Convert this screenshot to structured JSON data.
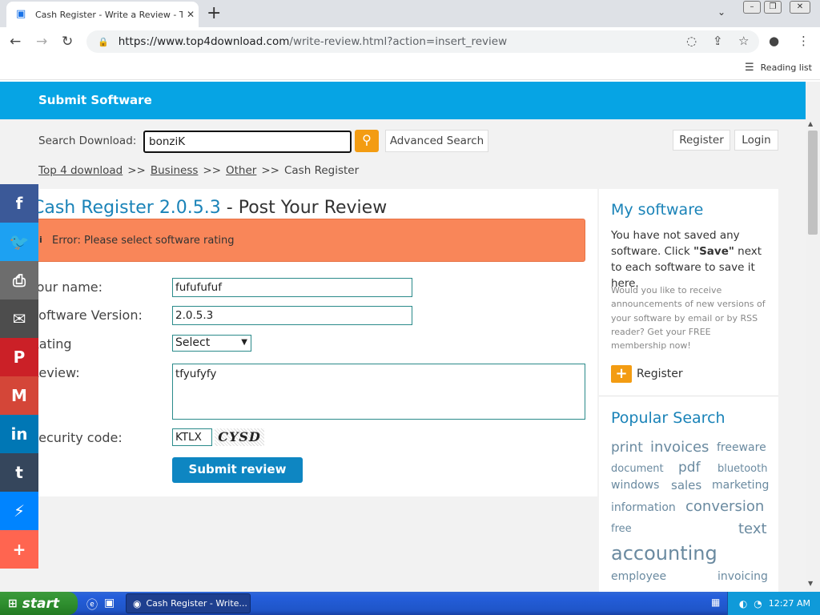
{
  "browser": {
    "tab_title": "Cash Register - Write a Review - To",
    "url_host": "https://www.top4download.com",
    "url_path": "/write-review.html?action=insert_review",
    "reading_list": "Reading list"
  },
  "header": {
    "title": "Submit Software"
  },
  "search": {
    "label": "Search Download:",
    "value": "bonziK",
    "advanced_label": "Advanced Search"
  },
  "account": {
    "register": "Register",
    "login": "Login"
  },
  "breadcrumb": {
    "home": "Top 4 download",
    "cat": "Business",
    "sub": "Other",
    "current": "Cash Register",
    "sep": ">>"
  },
  "form": {
    "product": "Cash Register 2.0.5.3",
    "title_suffix": " - Post Your Review",
    "error": "Error: Please select software rating",
    "name_label": "Your name:",
    "name_value": "fufufufuf",
    "version_label": "Software Version:",
    "version_value": "2.0.5.3",
    "rating_label": "Rating",
    "rating_value": "Select",
    "review_label": "Review:",
    "review_value": "tfyufyfy",
    "security_label": "Security code:",
    "security_value": "KTLX",
    "captcha_text": "CYSD",
    "submit": "Submit review"
  },
  "sidebar": {
    "my_software_title": "My software",
    "my_software_text_1": "You have not saved any software. Click ",
    "my_software_save": "\"Save\"",
    "my_software_text_2": " next to each software to save it here.",
    "promo": "Would you like to receive announcements of new versions of your software by email or by RSS reader? Get your FREE membership now!",
    "register": "Register",
    "popular_title": "Popular Search",
    "tags": [
      "print",
      "invoices",
      "freeware",
      "document",
      "pdf",
      "bluetooth",
      "windows",
      "sales",
      "marketing",
      "information",
      "conversion",
      "free",
      "text",
      "accounting",
      "employee",
      "invoicing"
    ]
  },
  "social": [
    {
      "name": "facebook",
      "glyph": "f",
      "color": "#3b5998"
    },
    {
      "name": "twitter",
      "glyph": "🐦",
      "color": "#1da1f2"
    },
    {
      "name": "print",
      "glyph": "⎙",
      "color": "#6d6d6d"
    },
    {
      "name": "email",
      "glyph": "✉",
      "color": "#4d4d4d"
    },
    {
      "name": "pinterest",
      "glyph": "P",
      "color": "#cb2027"
    },
    {
      "name": "gmail",
      "glyph": "M",
      "color": "#d44638"
    },
    {
      "name": "linkedin",
      "glyph": "in",
      "color": "#0077b5"
    },
    {
      "name": "tumblr",
      "glyph": "t",
      "color": "#35465c"
    },
    {
      "name": "messenger",
      "glyph": "⚡",
      "color": "#0084ff"
    },
    {
      "name": "more",
      "glyph": "+",
      "color": "#ff6550"
    }
  ],
  "taskbar": {
    "start": "start",
    "item": "Cash Register - Write...",
    "clock": "12:27 AM"
  }
}
